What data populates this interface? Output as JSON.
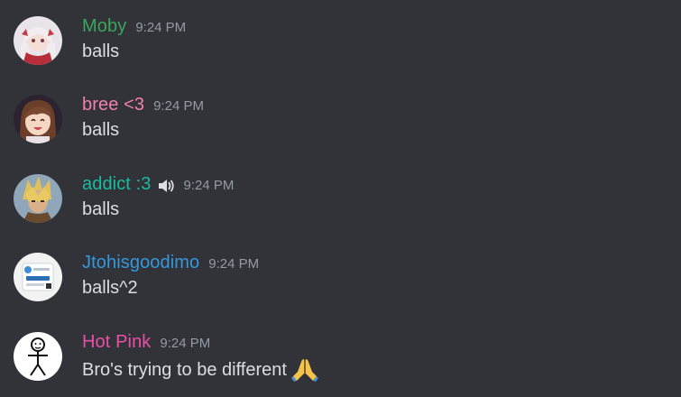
{
  "messages": [
    {
      "username": "Moby",
      "username_color": "#3ba55d",
      "timestamp": "9:24 PM",
      "text": "balls",
      "avatar": "anime-girl-avatar"
    },
    {
      "username": "bree <3",
      "username_color": "#f47fb0",
      "timestamp": "9:24 PM",
      "text": "balls",
      "avatar": "anime-girl-brown-hair-avatar"
    },
    {
      "username": "addict :3",
      "username_color": "#1abc9c",
      "timestamp": "9:24 PM",
      "text": "balls",
      "avatar": "anime-boy-avatar",
      "status_icon": "speaker-icon"
    },
    {
      "username": "Jtohisgoodimo",
      "username_color": "#3498db",
      "timestamp": "9:24 PM",
      "text": "balls^2",
      "avatar": "app-logo-avatar"
    },
    {
      "username": "Hot Pink",
      "username_color": "#e94fa6",
      "timestamp": "9:24 PM",
      "text": "Bro's trying to be different",
      "avatar": "stick-figure-avatar",
      "emoji": "folded-hands-emoji"
    }
  ]
}
